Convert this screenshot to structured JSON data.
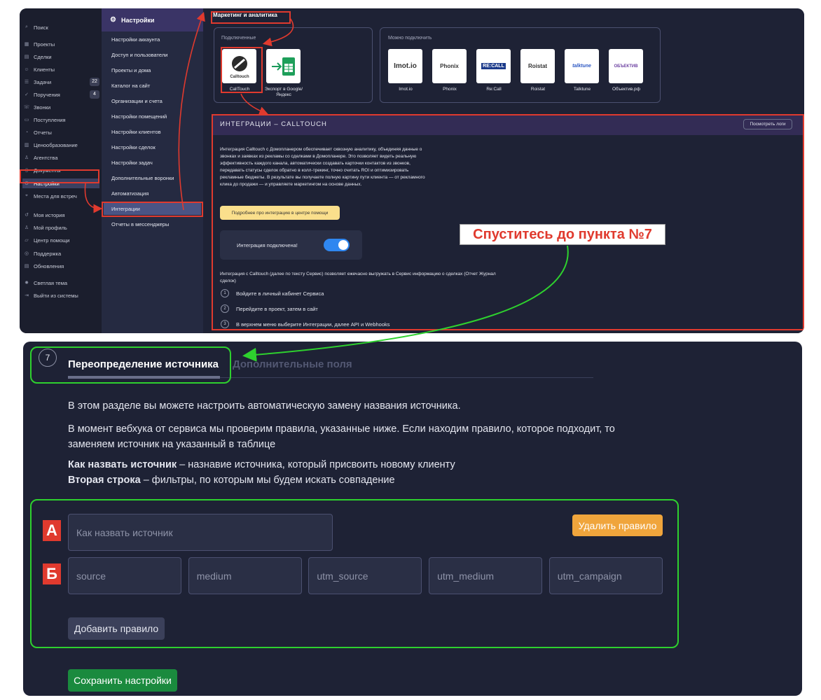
{
  "sidebar": {
    "search": "Поиск",
    "items": [
      {
        "label": "Проекты",
        "icon": "projects-icon",
        "glyph": "▦"
      },
      {
        "label": "Сделки",
        "icon": "deals-icon",
        "glyph": "▤"
      },
      {
        "label": "Клиенты",
        "icon": "clients-icon",
        "glyph": "☺"
      },
      {
        "label": "Задачи",
        "icon": "tasks-icon",
        "glyph": "☰",
        "badge": "22"
      },
      {
        "label": "Поручения",
        "icon": "assignments-icon",
        "glyph": "✓",
        "badge": "4"
      },
      {
        "label": "Звонки",
        "icon": "phone-icon",
        "glyph": "☏"
      },
      {
        "label": "Поступления",
        "icon": "income-icon",
        "glyph": "▭"
      },
      {
        "label": "Отчеты",
        "icon": "reports-icon",
        "glyph": "◔"
      },
      {
        "label": "Ценообразование",
        "icon": "pricing-icon",
        "glyph": "▥"
      },
      {
        "label": "Агентства",
        "icon": "agency-icon",
        "glyph": "♙"
      },
      {
        "label": "Документы",
        "icon": "documents-icon",
        "glyph": "▯"
      },
      {
        "label": "Настройки",
        "icon": "gear-icon",
        "glyph": "⚙",
        "active": true
      },
      {
        "label": "Места для встреч",
        "icon": "location-icon",
        "glyph": "⌖"
      },
      {
        "label": "Моя история",
        "icon": "history-icon",
        "glyph": "↺"
      },
      {
        "label": "Мой профиль",
        "icon": "profile-icon",
        "glyph": "♙"
      },
      {
        "label": "Центр помощи",
        "icon": "help-icon",
        "glyph": "▱"
      },
      {
        "label": "Поддержка",
        "icon": "support-icon",
        "glyph": "◎"
      },
      {
        "label": "Обновления",
        "icon": "updates-icon",
        "glyph": "▤"
      },
      {
        "label": "Светлая тема",
        "icon": "theme-icon",
        "glyph": "✹"
      },
      {
        "label": "Выйти из системы",
        "icon": "logout-icon",
        "glyph": "⇥"
      }
    ]
  },
  "settings_nav": {
    "title": "Настройки",
    "items": [
      "Настройки аккаунта",
      "Доступ и пользователи",
      "Проекты и дома",
      "Каталог на сайт",
      "Организации и счета",
      "Настройки помещений",
      "Настройки клиентов",
      "Настройки сделок",
      "Настройки задач",
      "Дополнительные воронки",
      "Автоматизация",
      "Интеграции",
      "Отчеты в мессенджеры"
    ],
    "active_index": 11
  },
  "marketing": {
    "tab": "Маркетинг и аналитика",
    "connected_label": "Подключенные",
    "connected": [
      {
        "name": "CallTouch",
        "logo": "Calltouch"
      },
      {
        "name": "Экспорт в Google/Яндекс",
        "logo": ""
      }
    ],
    "available_label": "Можно подключить",
    "available": [
      {
        "name": "Imot.io",
        "logo": "Imot.io"
      },
      {
        "name": "Phonix",
        "logo": "Phonix"
      },
      {
        "name": "Re:Call",
        "logo": "RE:CALL"
      },
      {
        "name": "Roistat",
        "logo": "Roistat"
      },
      {
        "name": "Talktune",
        "logo": "talktune"
      },
      {
        "name": "Объектив.рф",
        "logo": "ОБЪЕКТИВ"
      }
    ]
  },
  "calltouch": {
    "title": "ИНТЕГРАЦИИ – CALLTOUCH",
    "logs_button": "Посмотреть логи",
    "description": "Интеграция Calltouch с Домопланером обеспечивает сквозную аналитику, объединяя данные о звонках и заявках из рекламы со сделками в Домопланере. Это позволяет видеть реальную эффективность каждого канала, автоматически создавать карточки контактов из звонков, передавать статусы сделок обратно в колл-трекинг, точно считать ROI и оптимизировать рекламные бюджеты. В результате вы получаете полную картину пути клиента — от рекламного клика до продажи — и управляете маркетингом на основе данных.",
    "help_button": "Подробнее про интеграцию в центре помощи",
    "toggle_label": "Интеграция подключена!",
    "toggle_on": true,
    "info": "Интеграция с Calltouch (далее по тексту Сервис) позволяет ежечасно выгружать в Сервис информацию о сделках (Отчет Журнал сделок)",
    "steps": [
      {
        "n": "1",
        "text": "Войдите в личный кабинет Сервиса"
      },
      {
        "n": "2",
        "text": "Перейдите в проект, затем в сайт"
      },
      {
        "n": "3",
        "text": "В верхнем меню выберите Интеграции, далее API и Webhooks"
      }
    ]
  },
  "annotation": "Спуститесь до пункта №7",
  "bottom": {
    "step_number": "7",
    "tab_active": "Переопределение источника",
    "tab_inactive": "Дополнительные поля",
    "para1": "В этом разделе вы можете настроить автоматическую замену названия источника.",
    "para2": "В момент вебхука от сервиса мы проверим правила, указанные ниже. Если находим правило, которое подходит, то заменяем источник на указанный в таблице",
    "line1_bold": "Как назвать источник",
    "line1_rest": " – назнавие источника, который присвоить новому клиенту",
    "line2_bold": "Вторая строка",
    "line2_rest": " – фильтры, по которым мы будем искать совпадение",
    "marker_a": "А",
    "marker_b": "Б",
    "source_name_placeholder": "Как назвать источник",
    "delete_rule": "Удалить правило",
    "filters": [
      "source",
      "medium",
      "utm_source",
      "utm_medium",
      "utm_campaign"
    ],
    "add_rule": "Добавить правило",
    "save": "Сохранить настройки"
  },
  "colors": {
    "accent_red": "#e03a2e",
    "accent_green": "#2ed12e",
    "toggle": "#2f87f0",
    "save": "#1a8a3e",
    "delete": "#f0a53c"
  }
}
